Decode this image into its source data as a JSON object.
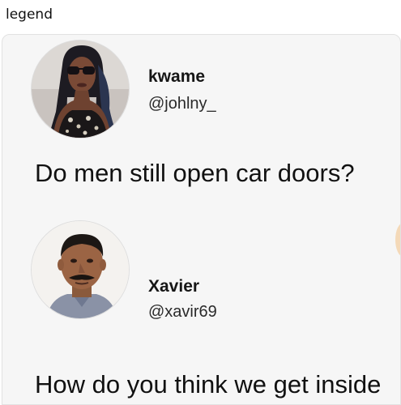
{
  "caption": "legend",
  "posts": [
    {
      "name": "kwame",
      "handle": "@johlny_",
      "text": "Do men still open car doors?"
    },
    {
      "name": "Xavier",
      "handle": "@xavir69",
      "text": "How do you think we get inside"
    }
  ],
  "colors": {
    "background": "#ffffff",
    "card": "#f6f6f6",
    "text": "#111111"
  }
}
